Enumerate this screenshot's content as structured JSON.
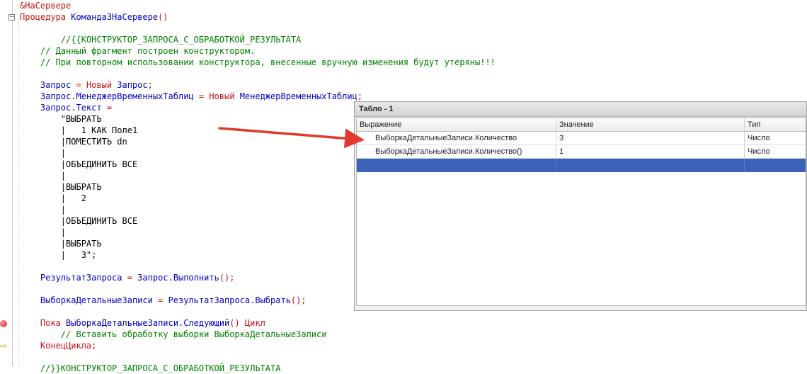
{
  "editor": {
    "lines": [
      [
        {
          "c": "kw",
          "t": "&НаСервере"
        }
      ],
      [
        {
          "c": "kw",
          "t": "Процедура "
        },
        {
          "c": "id",
          "t": "Команда3НаСервере"
        },
        {
          "c": "op",
          "t": "()"
        }
      ],
      [],
      [
        {
          "c": "cm",
          "t": "        //{{КОНСТРУКТОР_ЗАПРОСА_С_ОБРАБОТКОЙ_РЕЗУЛЬТАТА"
        }
      ],
      [
        {
          "c": "cm",
          "t": "    // Данный фрагмент построен конструктором."
        }
      ],
      [
        {
          "c": "cm",
          "t": "    // При повторном использовании конструктора, внесенные вручную изменения будут утеряны!!!"
        }
      ],
      [],
      [
        {
          "c": "id",
          "t": "    Запрос "
        },
        {
          "c": "op",
          "t": "= "
        },
        {
          "c": "kw",
          "t": "Новый "
        },
        {
          "c": "id",
          "t": "Запрос"
        },
        {
          "c": "op",
          "t": ";"
        }
      ],
      [
        {
          "c": "id",
          "t": "    Запрос.МенеджерВременныхТаблиц "
        },
        {
          "c": "op",
          "t": "= "
        },
        {
          "c": "kw",
          "t": "Новый "
        },
        {
          "c": "id",
          "t": "МенеджерВременныхТаблиц"
        },
        {
          "c": "op",
          "t": ";"
        }
      ],
      [
        {
          "c": "id",
          "t": "    Запрос.Текст "
        },
        {
          "c": "op",
          "t": "="
        }
      ],
      [
        {
          "c": "txt",
          "t": "        \"ВЫБРАТЬ"
        }
      ],
      [
        {
          "c": "txt",
          "t": "        |   1 КАК Поле1"
        }
      ],
      [
        {
          "c": "txt",
          "t": "        |ПОМЕСТИТЬ dn"
        }
      ],
      [
        {
          "c": "txt",
          "t": "        |"
        }
      ],
      [
        {
          "c": "txt",
          "t": "        |ОБЪЕДИНИТЬ ВСЕ"
        }
      ],
      [
        {
          "c": "txt",
          "t": "        |"
        }
      ],
      [
        {
          "c": "txt",
          "t": "        |ВЫБРАТЬ"
        }
      ],
      [
        {
          "c": "txt",
          "t": "        |   2"
        }
      ],
      [
        {
          "c": "txt",
          "t": "        |"
        }
      ],
      [
        {
          "c": "txt",
          "t": "        |ОБЪЕДИНИТЬ ВСЕ"
        }
      ],
      [
        {
          "c": "txt",
          "t": "        |"
        }
      ],
      [
        {
          "c": "txt",
          "t": "        |ВЫБРАТЬ"
        }
      ],
      [
        {
          "c": "txt",
          "t": "        |   3\";"
        }
      ],
      [],
      [
        {
          "c": "id",
          "t": "    РезультатЗапроса "
        },
        {
          "c": "op",
          "t": "= "
        },
        {
          "c": "id",
          "t": "Запрос.Выполнить"
        },
        {
          "c": "op",
          "t": "();"
        }
      ],
      [],
      [
        {
          "c": "id",
          "t": "    ВыборкаДетальныеЗаписи "
        },
        {
          "c": "op",
          "t": "= "
        },
        {
          "c": "id",
          "t": "РезультатЗапроса.Выбрать"
        },
        {
          "c": "op",
          "t": "();"
        }
      ],
      [],
      [
        {
          "c": "kw",
          "t": "    Пока "
        },
        {
          "c": "id",
          "t": "ВыборкаДетальныеЗаписи.Следующий"
        },
        {
          "c": "op",
          "t": "() "
        },
        {
          "c": "kw",
          "t": "Цикл"
        }
      ],
      [
        {
          "c": "cm",
          "t": "        // Вставить обработку выборки ВыборкаДетальныеЗаписи"
        }
      ],
      [
        {
          "c": "kw",
          "t": "    КонецЦикла"
        },
        {
          "c": "op",
          "t": ";"
        }
      ],
      [],
      [
        {
          "c": "cm",
          "t": "    //}}КОНСТРУКТОР_ЗАПРОСА_С_ОБРАБОТКОЙ_РЕЗУЛЬТАТА"
        }
      ]
    ]
  },
  "tablo": {
    "title": "Табло - 1",
    "columns": [
      "Выражение",
      "Значение",
      "Тип"
    ],
    "rows": [
      [
        "ВыборкаДетальныеЗаписи.Количество",
        "3",
        "Число"
      ],
      [
        "ВыборкаДетальныеЗаписи.Количество()",
        "1",
        "Число"
      ]
    ]
  },
  "colors": {
    "keyword": "#c81414",
    "identifier": "#0000c8",
    "comment": "#008000",
    "selection": "#3a62b9",
    "arrow": "#e03a2e"
  }
}
